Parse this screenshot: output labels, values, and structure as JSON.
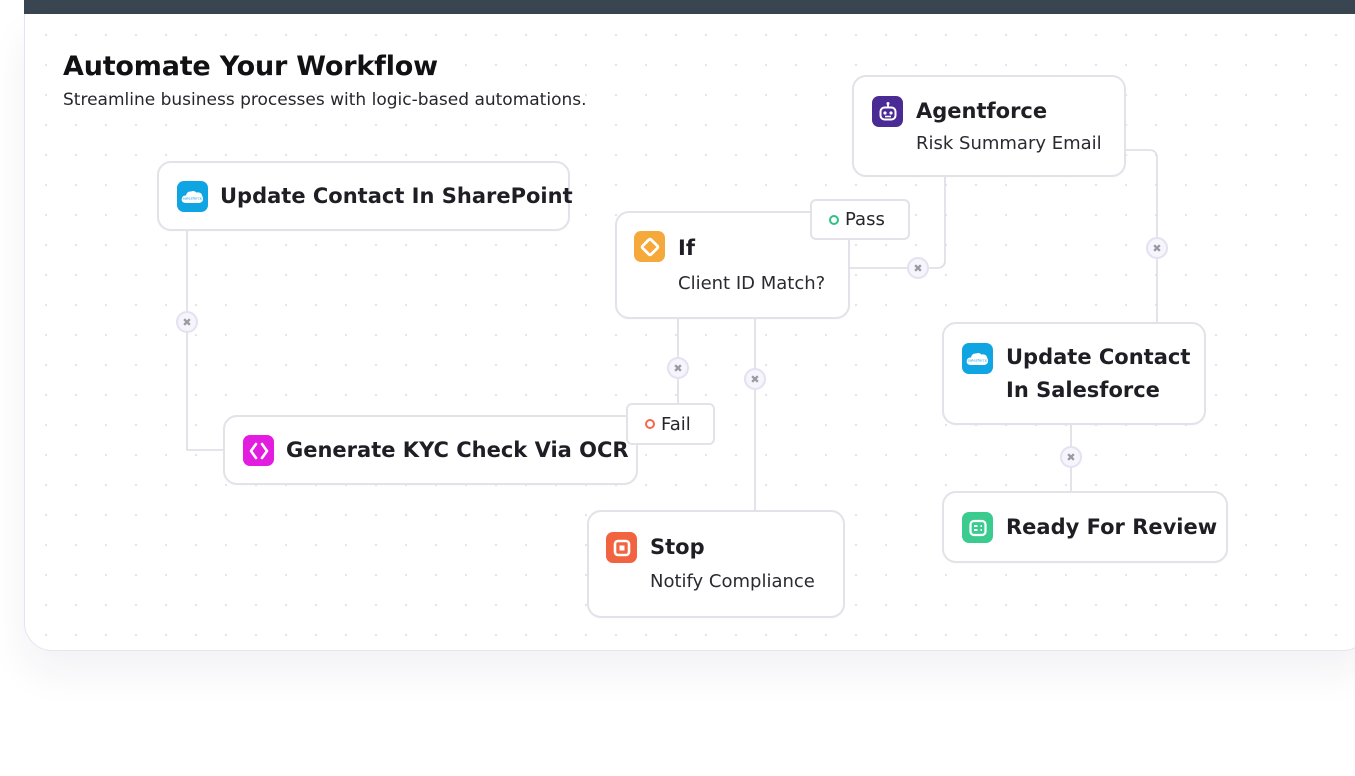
{
  "header": {
    "title": "Automate Your Workflow",
    "subtitle": "Streamline business processes with logic-based automations."
  },
  "nodes": {
    "sharepoint": {
      "title": "Update Contact In SharePoint",
      "icon": "salesforce-cloud-icon",
      "icon_text": "salesforce",
      "color": "#0ea5e2"
    },
    "kyc": {
      "title": "Generate KYC Check Via OCR",
      "icon": "code-brackets-icon",
      "color": "#e21ddf"
    },
    "if": {
      "title": "If",
      "subtitle": "Client ID Match?",
      "icon": "diamond-icon",
      "color": "#f6a93b"
    },
    "stop": {
      "title": "Stop",
      "subtitle": "Notify Compliance",
      "icon": "stop-icon",
      "color": "#f26340"
    },
    "agentforce": {
      "title": "Agentforce",
      "subtitle": "Risk Summary Email",
      "icon": "robot-icon",
      "color": "#4a2a94"
    },
    "salesforce": {
      "title_line1": "Update Contact",
      "title_line2": "In Salesforce",
      "icon": "salesforce-cloud-icon",
      "icon_text": "salesforce",
      "color": "#0ea5e2"
    },
    "review": {
      "title": "Ready For Review",
      "icon": "review-icon",
      "color": "#3ccb8f"
    }
  },
  "badges": {
    "pass": {
      "label": "Pass",
      "color": "#2fc185"
    },
    "fail": {
      "label": "Fail",
      "color": "#f5684d"
    }
  },
  "connector": {
    "icon": "close-icon",
    "glyph": "✖"
  },
  "colors": {
    "topbar": "#394651",
    "border": "#e2e2e8",
    "wire": "#dcdce4"
  }
}
